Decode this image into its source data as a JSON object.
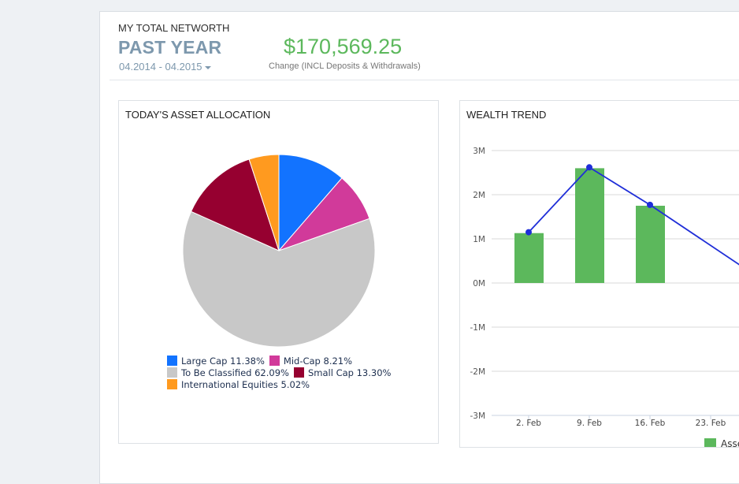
{
  "header": {
    "label": "MY TOTAL NETWORTH",
    "period": "PAST YEAR",
    "range": "04.2014 - 04.2015",
    "amount": "$170,569.25",
    "change_label": "Change (INCL Deposits & Withdrawals)"
  },
  "allocation": {
    "title": "TODAY'S ASSET ALLOCATION",
    "legend": [
      {
        "label": "Large Cap 11.38%",
        "color": "#1273ff"
      },
      {
        "label": "Mid-Cap 8.21%",
        "color": "#d13a9a"
      },
      {
        "label": "To Be Classified 62.09%",
        "color": "#c8c8c8"
      },
      {
        "label": "Small Cap 13.30%",
        "color": "#960030"
      },
      {
        "label": "International Equities 5.02%",
        "color": "#ff9a1f"
      }
    ]
  },
  "trend": {
    "title": "WEALTH TREND",
    "legend_label": "Asse"
  },
  "chart_data": [
    {
      "type": "pie",
      "title": "TODAY'S ASSET ALLOCATION",
      "categories": [
        "Large Cap",
        "Mid-Cap",
        "To Be Classified",
        "Small Cap",
        "International Equities"
      ],
      "values": [
        11.38,
        8.21,
        62.09,
        13.3,
        5.02
      ],
      "colors": [
        "#1273ff",
        "#d13a9a",
        "#c8c8c8",
        "#960030",
        "#ff9a1f"
      ],
      "legend": "bottom"
    },
    {
      "type": "bar",
      "title": "WEALTH TREND",
      "categories": [
        "2. Feb",
        "9. Feb",
        "16. Feb",
        "23. Feb"
      ],
      "series": [
        {
          "name": "Asse",
          "type": "bar",
          "color": "#5cb85c",
          "values": [
            1.13,
            2.6,
            1.75,
            null
          ]
        },
        {
          "type": "line",
          "color": "#1f2ed8",
          "values": [
            1.15,
            2.62,
            1.77,
            0.85
          ]
        }
      ],
      "yticks": [
        "3M",
        "2M",
        "1M",
        "0M",
        "-1M",
        "-2M",
        "-3M"
      ],
      "ylim": [
        -3,
        3
      ],
      "grid": true,
      "legend": "bottom-right"
    }
  ]
}
